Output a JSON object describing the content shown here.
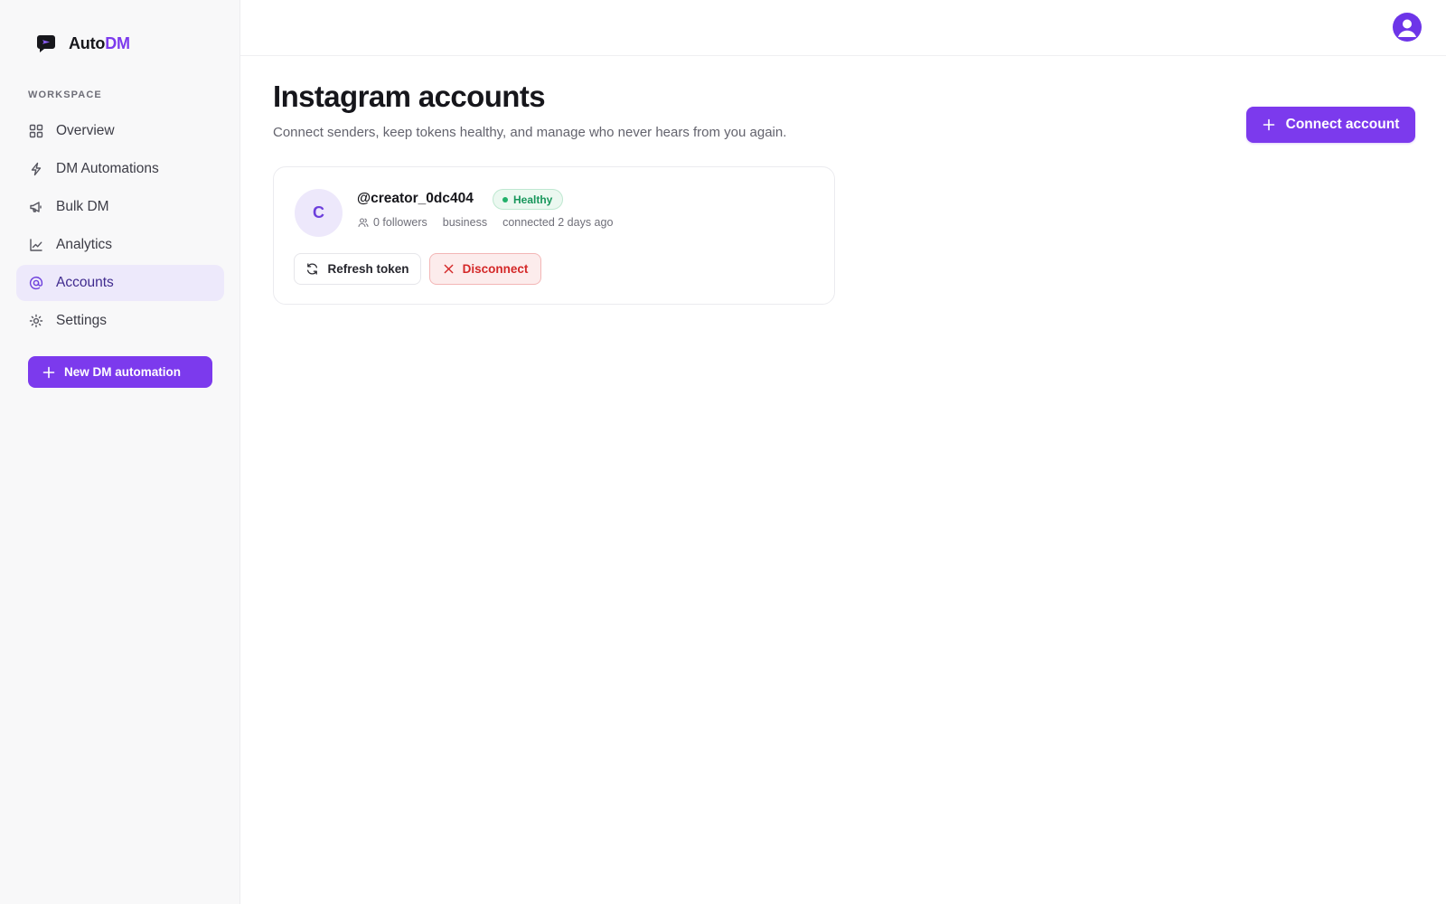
{
  "brand": {
    "name_part1": "Auto",
    "name_part2": "DM",
    "logo_icon": "chat-bubble-send-icon",
    "accent_color": "#7c3aed"
  },
  "sidebar": {
    "section_label": "WORKSPACE",
    "items": [
      {
        "label": "Overview",
        "icon": "grid-icon",
        "active": false
      },
      {
        "label": "DM Automations",
        "icon": "lightning-icon",
        "active": false
      },
      {
        "label": "Bulk DM",
        "icon": "megaphone-icon",
        "active": false
      },
      {
        "label": "Analytics",
        "icon": "line-chart-icon",
        "active": false
      },
      {
        "label": "Accounts",
        "icon": "at-sign-icon",
        "active": true
      },
      {
        "label": "Settings",
        "icon": "sun-gear-icon",
        "active": false
      }
    ],
    "new_button_label": "New DM automation"
  },
  "topbar": {
    "avatar_icon": "user-avatar-icon"
  },
  "main": {
    "title": "Instagram accounts",
    "subtitle": "Connect senders, keep tokens healthy, and manage who never hears from you again.",
    "connect_button_label": "Connect account",
    "accounts": [
      {
        "initial": "C",
        "handle": "@creator_0dc404",
        "status": "Healthy",
        "status_color": "#17965b",
        "followers": "0 followers",
        "type": "business",
        "connected": "connected 2 days ago",
        "refresh_label": "Refresh token",
        "disconnect_label": "Disconnect",
        "disconnect_color": "#d42828"
      }
    ]
  }
}
